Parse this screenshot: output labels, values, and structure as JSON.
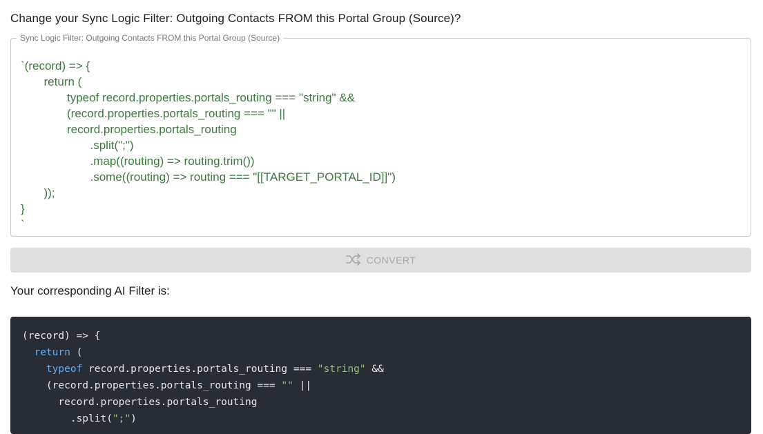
{
  "heading": "Change your Sync Logic Filter: Outgoing Contacts FROM this Portal Group (Source)?",
  "source": {
    "legend": "Sync Logic Filter: Outgoing Contacts FROM this Portal Group (Source)",
    "lines": [
      {
        "indent": 0,
        "text": "`(record) => {"
      },
      {
        "indent": 1,
        "text": "return ("
      },
      {
        "indent": 2,
        "text": "typeof record.properties.portals_routing === \"string\" &&"
      },
      {
        "indent": 2,
        "text": "(record.properties.portals_routing === \"\" ||"
      },
      {
        "indent": 2,
        "text": "record.properties.portals_routing"
      },
      {
        "indent": 3,
        "text": ".split(\";\")"
      },
      {
        "indent": 3,
        "text": ".map((routing) => routing.trim())"
      },
      {
        "indent": 3,
        "text": ".some((routing) => routing === \"[[TARGET_PORTAL_ID]]\")"
      },
      {
        "indent": 1,
        "text": "));"
      },
      {
        "indent": 0,
        "text": "}"
      },
      {
        "indent": 0,
        "text": "`"
      }
    ]
  },
  "convert_button": {
    "label": "CONVERT",
    "icon": "shuffle-icon"
  },
  "result_label": "Your corresponding AI Filter is:",
  "result_code": [
    [
      {
        "t": "(record) => {",
        "k": ""
      }
    ],
    [
      {
        "t": "  ",
        "k": ""
      },
      {
        "t": "return",
        "k": "kw"
      },
      {
        "t": " (",
        "k": ""
      }
    ],
    [
      {
        "t": "    ",
        "k": ""
      },
      {
        "t": "typeof",
        "k": "kw"
      },
      {
        "t": " record.properties.portals_routing === ",
        "k": ""
      },
      {
        "t": "\"string\"",
        "k": "str"
      },
      {
        "t": " &&",
        "k": ""
      }
    ],
    [
      {
        "t": "    (record.properties.portals_routing === ",
        "k": ""
      },
      {
        "t": "\"\"",
        "k": "str"
      },
      {
        "t": " ||",
        "k": ""
      }
    ],
    [
      {
        "t": "      record.properties.portals_routing",
        "k": ""
      }
    ],
    [
      {
        "t": "        .split(",
        "k": ""
      },
      {
        "t": "\";\"",
        "k": "str"
      },
      {
        "t": ")",
        "k": ""
      }
    ]
  ]
}
